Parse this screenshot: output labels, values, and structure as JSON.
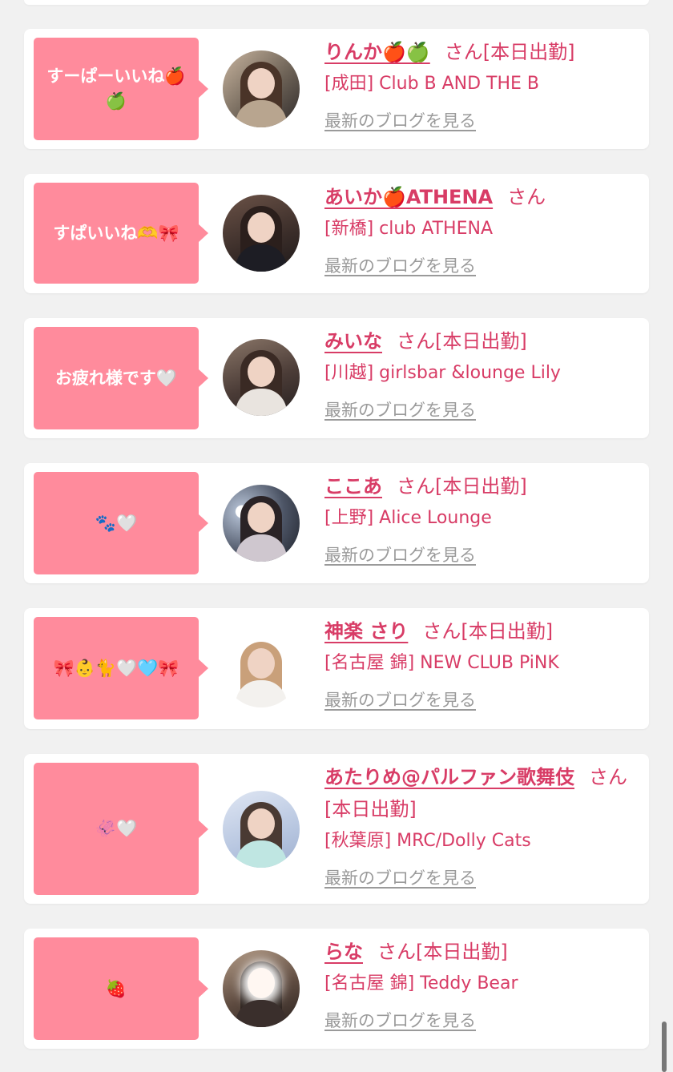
{
  "cards": [
    {
      "message": "すーぱーいいね🍎🍏",
      "name": "りんか🍎🍏",
      "honorific": "さん",
      "status": "[本日出勤]",
      "shop": "[成田] Club B AND THE B",
      "blog_link": "最新のブログを見る"
    },
    {
      "message": "すぱいいね🫶🎀",
      "name": "あいか🍎ATHENA",
      "honorific": "さん",
      "status": "",
      "shop": "[新橋] club ATHENA",
      "blog_link": "最新のブログを見る"
    },
    {
      "message": "お疲れ様です🤍",
      "name": "みいな",
      "honorific": "さん",
      "status": "[本日出勤]",
      "shop": "[川越] girlsbar &lounge Lily",
      "blog_link": "最新のブログを見る"
    },
    {
      "message": "🐾🤍",
      "name": "ここあ",
      "honorific": "さん",
      "status": "[本日出勤]",
      "shop": "[上野] Alice Lounge",
      "blog_link": "最新のブログを見る"
    },
    {
      "message": "🎀👶🐈🤍🩵🎀",
      "name": "神楽 さり",
      "honorific": "さん",
      "status": "[本日出勤]",
      "shop": "[名古屋 錦] NEW CLUB PiNK",
      "blog_link": "最新のブログを見る"
    },
    {
      "message": "🦑🤍",
      "name": "あたりめ@パルファン歌舞伎",
      "honorific": "さん",
      "status": "[本日出勤]",
      "shop": "[秋葉原] MRC/Dolly Cats",
      "blog_link": "最新のブログを見る"
    },
    {
      "message": "🍓",
      "name": "らな",
      "honorific": "さん",
      "status": "[本日出勤]",
      "shop": "[名古屋 錦] Teddy Bear",
      "blog_link": "最新のブログを見る"
    }
  ],
  "colors": {
    "bubble": "#ff8b9c",
    "name": "#d83c66",
    "link_gray": "#9a9a9a",
    "background": "#f1f1f1"
  }
}
